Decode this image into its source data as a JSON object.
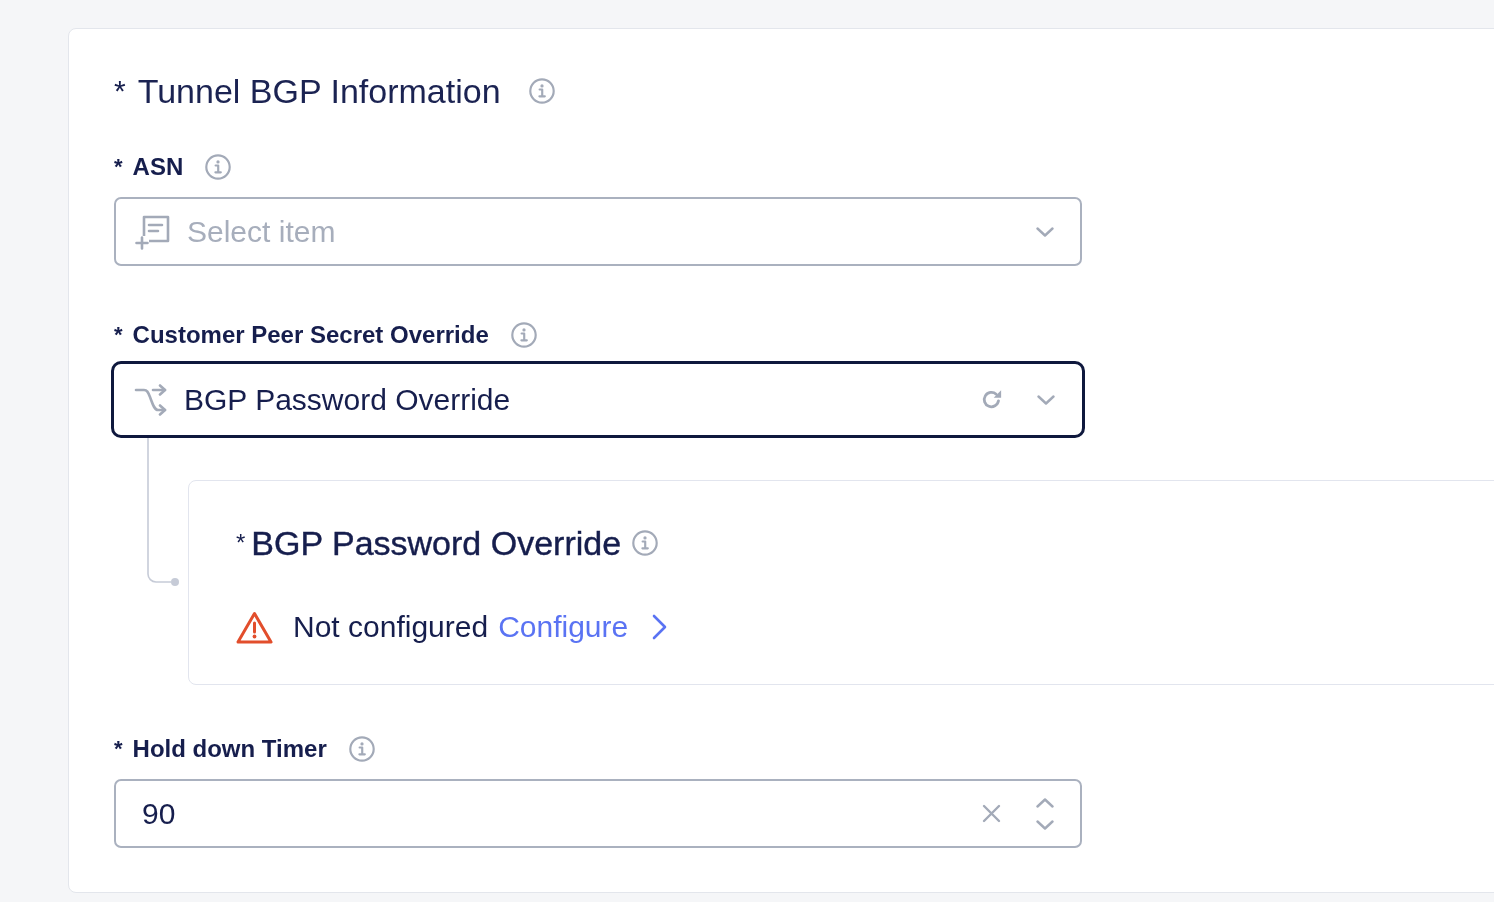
{
  "section": {
    "required_marker": "*",
    "title": "Tunnel BGP Information",
    "fields": [
      {
        "kind": "select",
        "required_marker": "*",
        "label": "ASN",
        "placeholder": "Select item",
        "focused": false
      },
      {
        "kind": "override-select",
        "required_marker": "*",
        "label": "Customer Peer Secret Override",
        "value": "BGP Password Override",
        "focused": true,
        "detail": {
          "required_marker": "*",
          "title": "BGP Password Override",
          "status": {
            "text": "Not configured",
            "link": "Configure"
          }
        }
      },
      {
        "kind": "number",
        "required_marker": "*",
        "label": "Hold down Timer",
        "value": "90",
        "focused": false
      }
    ]
  }
}
